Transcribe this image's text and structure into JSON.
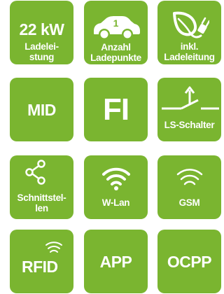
{
  "colors": {
    "tile_green": "#7ab530",
    "foreground": "#ffffff"
  },
  "tiles": [
    {
      "lines": [
        "22 kW",
        "Ladelei-",
        "stung"
      ]
    },
    {
      "badge": "1",
      "lines": [
        "Anzahl",
        "Ladepunkte"
      ],
      "icon": "car-icon"
    },
    {
      "lines": [
        "inkl.",
        "Ladeleitung"
      ],
      "icon": "leaf-plug-icon"
    },
    {
      "label": "MID"
    },
    {
      "label": "FI"
    },
    {
      "label": "LS-Schalter",
      "icon": "switch-icon"
    },
    {
      "lines": [
        "Schnittstel-",
        "len"
      ],
      "icon": "share-icon"
    },
    {
      "label": "W-Lan",
      "icon": "wifi-icon"
    },
    {
      "label": "GSM",
      "icon": "signal-icon"
    },
    {
      "label": "RFID",
      "icon": "rfid-waves-icon"
    },
    {
      "label": "APP"
    },
    {
      "label": "OCPP"
    }
  ]
}
